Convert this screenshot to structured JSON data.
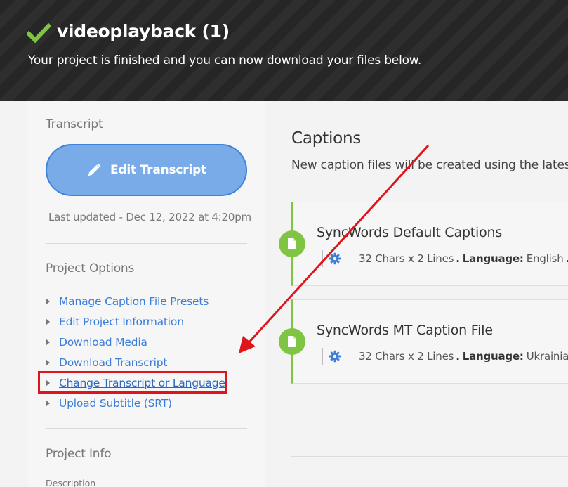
{
  "header": {
    "title": "videoplayback (1)",
    "subtitle": "Your project is finished and you can now download your files below."
  },
  "sidebar": {
    "transcript_heading": "Transcript",
    "edit_transcript_label": "Edit Transcript",
    "last_updated": "Last updated - Dec 12, 2022 at 4:20pm",
    "project_options_heading": "Project Options",
    "options": [
      "Manage Caption File Presets",
      "Edit Project Information",
      "Download Media",
      "Download Transcript",
      "Change Transcript or Language",
      "Upload Subtitle (SRT)"
    ],
    "project_info_heading": "Project Info",
    "description_label": "Description"
  },
  "main": {
    "captions_title": "Captions",
    "captions_desc": "New caption files will be created using the latest",
    "cards": [
      {
        "title": "SyncWords Default Captions",
        "spec": "32 Chars x 2 Lines",
        "sep": ".",
        "language_label": "Language:",
        "language": "English",
        "trailing": "."
      },
      {
        "title": "SyncWords MT Caption File",
        "spec": "32 Chars x 2 Lines",
        "sep": ".",
        "language_label": "Language:",
        "language": "Ukrainian",
        "trailing": ""
      }
    ]
  },
  "colors": {
    "accent_blue": "#3b7dd8",
    "button_blue": "#79abe9",
    "success_green": "#7fc543",
    "annotation_red": "#e0141b"
  }
}
